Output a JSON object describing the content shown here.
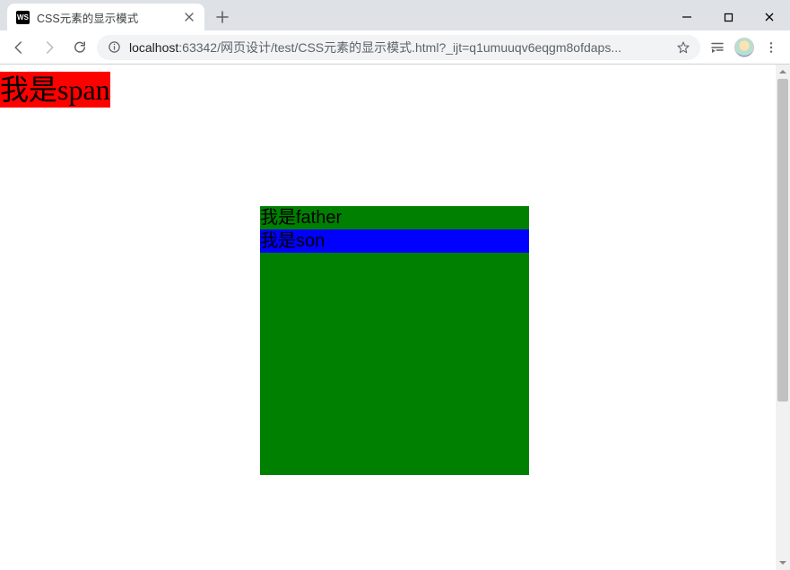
{
  "window": {
    "tab_title": "CSS元素的显示模式",
    "favicon_text": "WS"
  },
  "toolbar": {
    "url_host": "localhost",
    "url_port": ":63342",
    "url_path": "/网页设计/test/CSS元素的显示模式.html?_ijt=q1umuuqv6eqgm8ofdaps..."
  },
  "page": {
    "span_text": "我是span",
    "father_text": "我是father",
    "son_text": "我是son"
  },
  "colors": {
    "span_bg": "#ff0000",
    "father_bg": "#008000",
    "son_bg": "#0000ff"
  }
}
